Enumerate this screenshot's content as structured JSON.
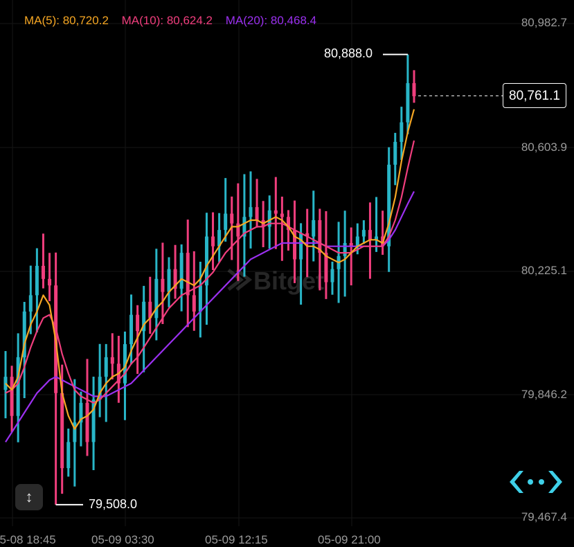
{
  "legend": {
    "ma5": {
      "label": "MA(5): 80,720.2",
      "color": "#f5a623"
    },
    "ma10": {
      "label": "MA(10): 80,624.2",
      "color": "#f03e7d"
    },
    "ma20": {
      "label": "MA(20): 80,468.4",
      "color": "#9b30f0"
    }
  },
  "colors": {
    "up": "#29b6c8",
    "down": "#f03e7d",
    "background": "#000000"
  },
  "watermark_icon": "bitget-logo-icon",
  "brand_icon": "bitget-chevrons-icon",
  "tool_icon": "vertical-arrows-icon",
  "current_price": "80,761.1",
  "high_label": "80,888.0",
  "low_label": "79,508.0",
  "chart_data": {
    "type": "candlestick",
    "y_ticks": [
      "80,982.7",
      "80,603.9",
      "80,225.1",
      "79,846.2",
      "79,467.4"
    ],
    "x_ticks": [
      "05-08 18:45",
      "05-09 03:30",
      "05-09 12:15",
      "05-09 21:00"
    ],
    "ylim": [
      79467.4,
      80982.7
    ],
    "grid": true,
    "current_price": 80761.1,
    "high": 80888.0,
    "low": 79508.0,
    "series_close": [
      79900,
      79780,
      79960,
      80100,
      80150,
      80240,
      80200,
      80180,
      79850,
      79620,
      79700,
      79760,
      79820,
      79700,
      79830,
      79900,
      79960,
      79940,
      79880,
      80000,
      80090,
      80040,
      80130,
      80080,
      80200,
      80160,
      80230,
      80170,
      80280,
      80150,
      80100,
      80180,
      80330,
      80300,
      80350,
      80400,
      80370,
      80330,
      80390,
      80420,
      80380,
      80360,
      80410,
      80400,
      80390,
      80350,
      80260,
      80340,
      80330,
      80380,
      80280,
      80190,
      80230,
      80270,
      80310,
      80300,
      80330,
      80350,
      80320,
      80330,
      80300,
      80550,
      80620,
      80680,
      80800,
      80760
    ],
    "ma5": [
      79880,
      79860,
      79900,
      80000,
      80060,
      80100,
      80150,
      80120,
      80010,
      79850,
      79780,
      79740,
      79770,
      79780,
      79800,
      79850,
      79880,
      79900,
      79910,
      79930,
      79980,
      80020,
      80060,
      80080,
      80110,
      80130,
      80160,
      80180,
      80200,
      80190,
      80180,
      80200,
      80240,
      80270,
      80300,
      80330,
      80360,
      80360,
      80370,
      80380,
      80380,
      80370,
      80380,
      80390,
      80380,
      80360,
      80330,
      80320,
      80300,
      80300,
      80290,
      80270,
      80260,
      80250,
      80260,
      80280,
      80300,
      80310,
      80320,
      80320,
      80310,
      80370,
      80450,
      80560,
      80650,
      80720
    ],
    "ma10": [
      79850,
      79860,
      79880,
      79930,
      79990,
      80040,
      80080,
      80090,
      80050,
      79970,
      79910,
      79860,
      79840,
      79830,
      79820,
      79830,
      79850,
      79870,
      79890,
      79910,
      79940,
      79960,
      79990,
      80020,
      80050,
      80080,
      80110,
      80130,
      80150,
      80160,
      80170,
      80180,
      80200,
      80220,
      80250,
      80280,
      80300,
      80320,
      80340,
      80350,
      80360,
      80360,
      80370,
      80370,
      80370,
      80360,
      80350,
      80340,
      80330,
      80320,
      80310,
      80300,
      80290,
      80280,
      80280,
      80280,
      80290,
      80300,
      80300,
      80300,
      80300,
      80330,
      80380,
      80450,
      80540,
      80624
    ],
    "ma20": [
      79700,
      79730,
      79760,
      79790,
      79820,
      79850,
      79870,
      79890,
      79900,
      79890,
      79880,
      79870,
      79860,
      79850,
      79840,
      79840,
      79840,
      79850,
      79860,
      79870,
      79880,
      79900,
      79920,
      79940,
      79960,
      79980,
      80000,
      80020,
      80040,
      80060,
      80080,
      80100,
      80120,
      80140,
      80160,
      80180,
      80200,
      80220,
      80240,
      80260,
      80270,
      80280,
      80290,
      80300,
      80310,
      80310,
      80310,
      80310,
      80310,
      80310,
      80310,
      80300,
      80300,
      80300,
      80300,
      80300,
      80300,
      80300,
      80300,
      80300,
      80300,
      80320,
      80350,
      80390,
      80430,
      80468
    ]
  }
}
